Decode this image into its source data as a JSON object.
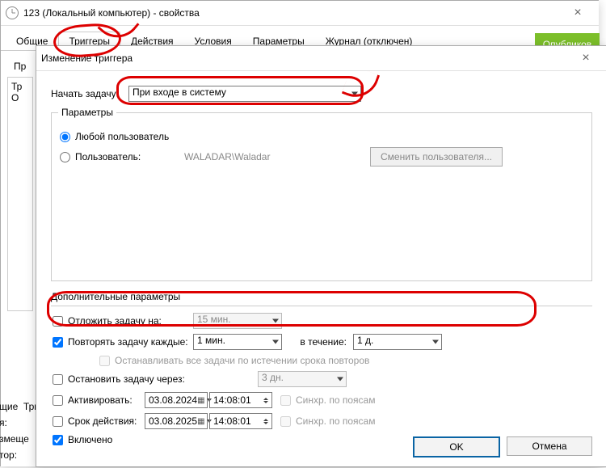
{
  "parent_window": {
    "title": "123 (Локальный компьютер) - свойства",
    "tabs": [
      "Общие",
      "Триггеры",
      "Действия",
      "Условия",
      "Параметры",
      "Журнал (отключен)"
    ],
    "active_tab": 1,
    "publish_btn": "Опубликов"
  },
  "dialog": {
    "title": "Изменение триггера",
    "begin_task_label": "Начать задачу:",
    "begin_task_value": "При входе в систему",
    "params_legend": "Параметры",
    "radio_any_user": "Любой пользователь",
    "radio_user": "Пользователь:",
    "user_value": "WALADAR\\Waladar",
    "change_user_btn": "Сменить пользователя...",
    "adv_legend": "Дополнительные параметры",
    "delay": {
      "label": "Отложить задачу на:",
      "value": "15 мин.",
      "checked": false
    },
    "repeat": {
      "label": "Повторять задачу каждые:",
      "value": "1 мин.",
      "for_label": "в течение:",
      "for_value": "1 д.",
      "checked": true
    },
    "repeat_stop": {
      "label": "Останавливать все задачи по истечении срока повторов",
      "checked": false
    },
    "stop_after": {
      "label": "Остановить задачу через:",
      "value": "3 дн.",
      "checked": false
    },
    "activate": {
      "label": "Активировать:",
      "date": "03.08.2024",
      "time": "14:08:01",
      "sync": "Синхр. по поясам",
      "checked": false
    },
    "expire": {
      "label": "Срок действия:",
      "date": "03.08.2025",
      "time": "14:08:01",
      "sync": "Синхр. по поясам",
      "checked": false
    },
    "enabled": {
      "label": "Включено",
      "checked": true
    },
    "ok": "OK",
    "cancel": "Отмена"
  },
  "bg": {
    "tabs_left": "щие",
    "tabs_right": "Триггеры",
    "row1": "я:",
    "row2": "змеще",
    "row3": "тор:"
  }
}
